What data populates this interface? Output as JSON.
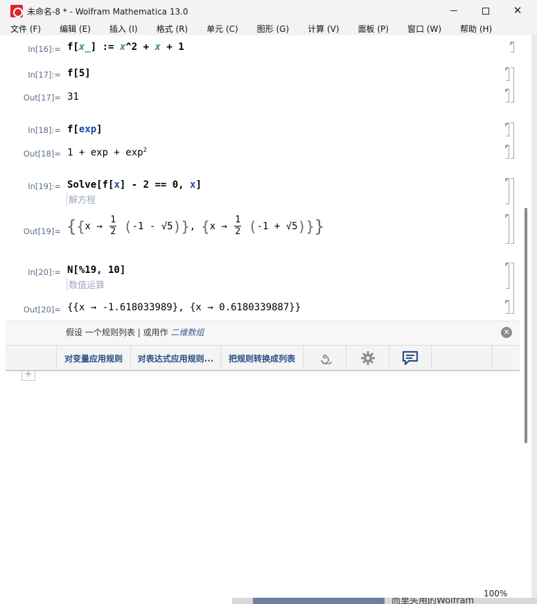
{
  "window": {
    "title": "未命名-8 * - Wolfram Mathematica 13.0",
    "minimize": "—",
    "maximize": "☐",
    "close": "✕"
  },
  "menu": [
    "文件 (F)",
    "编辑 (E)",
    "插入 (I)",
    "格式 (R)",
    "单元 (C)",
    "图形 (G)",
    "计算 (V)",
    "面板 (P)",
    "窗口 (W)",
    "帮助 (H)"
  ],
  "cells": {
    "in16": {
      "label": "In[16]:=",
      "f": "f[",
      "x_": "x_",
      "mid": "] := ",
      "x1": "x",
      "pow": "^2 + ",
      "x2": "x",
      "tail": " + 1"
    },
    "in17": {
      "label": "In[17]:=",
      "code": "f[5]"
    },
    "out17": {
      "label": "Out[17]=",
      "value": "31"
    },
    "in18": {
      "label": "In[18]:=",
      "pre": "f[",
      "arg": "exp",
      "post": "]"
    },
    "out18": {
      "label": "Out[18]=",
      "value": "1 + exp + exp",
      "sup": "2"
    },
    "in19": {
      "label": "In[19]:=",
      "pre": "Solve[f[",
      "x1": "x",
      "mid": "] - 2 == 0, ",
      "x2": "x",
      "post": "]",
      "hint": "解方程"
    },
    "out19": {
      "label": "Out[19]=",
      "sol1_pre": "x →",
      "sol1_num": "1",
      "sol1_den": "2",
      "sol1_inner": "-1 - √5",
      "sol2_pre": "x →",
      "sol2_num": "1",
      "sol2_den": "2",
      "sol2_inner": "-1 + √5"
    },
    "in20": {
      "label": "In[20]:=",
      "code": "N[%19, 10]",
      "hint": "数值运算"
    },
    "out20": {
      "label": "Out[20]=",
      "value": "{{x → -1.618033989}, {x → 0.6180339887}}"
    }
  },
  "suggestions": {
    "prefix": "假设 一个规则列表 | 或用作 ",
    "alt": "二维数组",
    "close_glyph": "✕",
    "buttons": [
      "对变量应用规则",
      "对表达式应用规则...",
      "把规则转换成列表"
    ],
    "icons": [
      "spiral-icon",
      "gear-icon",
      "chat-icon"
    ]
  },
  "new_cell": "+",
  "status": {
    "zoom": "100%"
  },
  "background_peek_text": "而里头用的Wolfram"
}
